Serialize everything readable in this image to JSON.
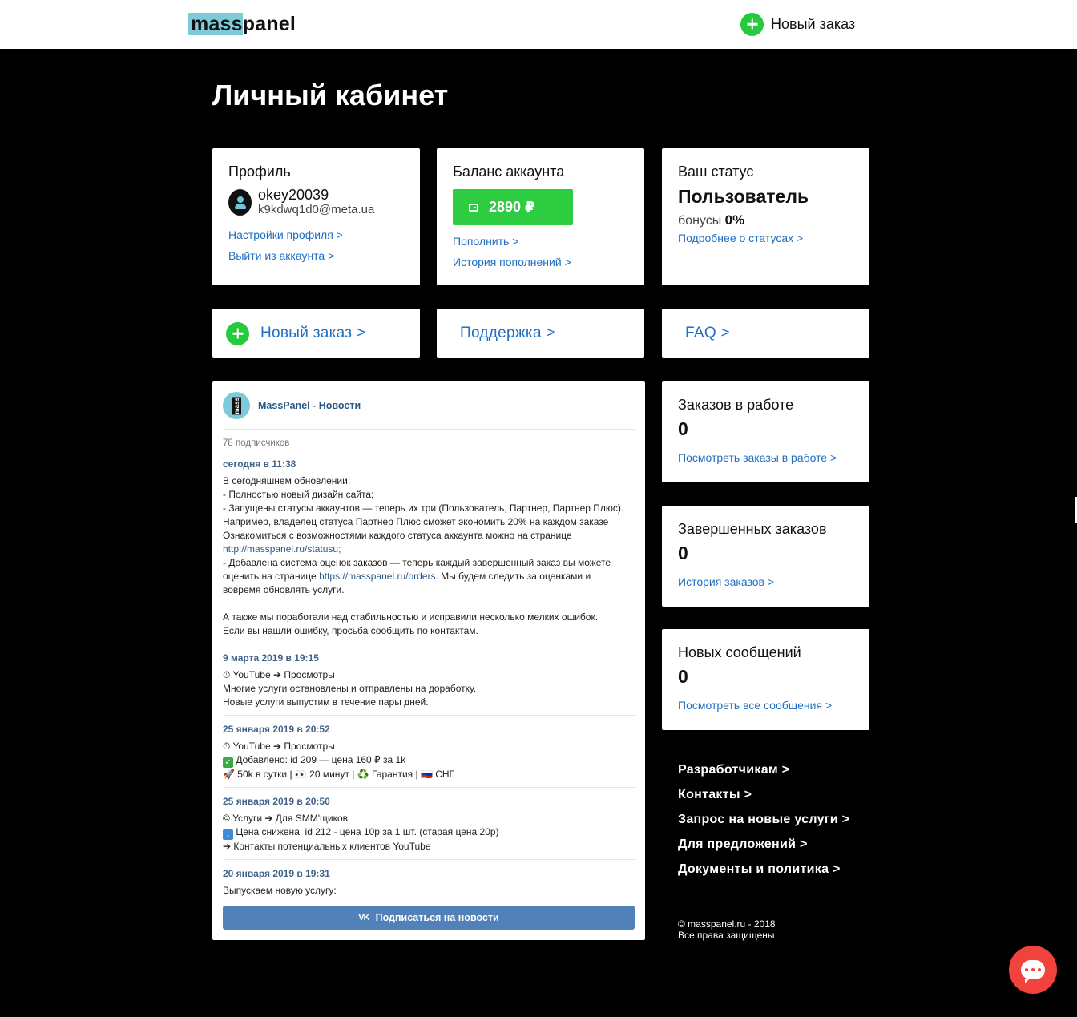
{
  "header": {
    "logo_highlight": "mass",
    "logo_rest": "panel",
    "new_order_label": "Новый заказ"
  },
  "page_title": "Личный кабинет",
  "profile": {
    "title": "Профиль",
    "username": "okey20039",
    "email": "k9kdwq1d0@meta.ua",
    "settings_link": "Настройки профиля >",
    "logout_link": "Выйти из аккаунта >"
  },
  "balance": {
    "title": "Баланс аккаунта",
    "amount": "2890 ₽",
    "topup_link": "Пополнить >",
    "history_link": "История пополнений >"
  },
  "status": {
    "title": "Ваш статус",
    "name": "Пользователь",
    "bonus_label": "бонусы",
    "bonus_value": "0%",
    "more_link": "Подробнее о статусах >"
  },
  "nav": {
    "new_order": "Новый заказ >",
    "support": "Поддержка >",
    "faq": "FAQ >"
  },
  "news": {
    "group_name": "MassPanel - Новости",
    "avatar_text": "mass",
    "subscribers": "78 подписчиков",
    "subscribe_button": "Подписаться на новости",
    "vk_icon": "VK",
    "posts": [
      {
        "date": "сегодня в 11:38",
        "lines": [
          "В сегодняшнем обновлении:",
          "- Полностью новый дизайн сайта;",
          "- Запущены статусы аккаунтов — теперь их три (Пользователь, Партнер, Партнер Плюс).",
          "Например, владелец статуса Партнер Плюс сможет экономить 20% на каждом заказе",
          "Ознакомиться с возможностями каждого статуса аккаунта можно на странице",
          "http://masspanel.ru/statusu;",
          "- Добавлена система оценок заказов — теперь каждый завершенный заказ вы можете",
          "оценить на странице ",
          "https://masspanel.ru/orders",
          ". Мы будем следить за оценками и",
          "вовремя обновлять услуги.",
          "А также мы поработали над стабильностью и исправили несколько мелких ошибок.",
          "Если вы нашли ошибку, просьба сообщить по контактам."
        ]
      },
      {
        "date": "9 марта 2019 в 19:15",
        "lines": [
          "⏱ YouTube ➔ Просмотры",
          "Многие услуги остановлены и отправлены на доработку.",
          "Новые услуги выпустим в течение пары дней."
        ]
      },
      {
        "date": "25 января 2019 в 20:52",
        "lines": [
          "⏱ YouTube ➔ Просмотры",
          "Добавлено: id 209 — цена 160 ₽ за 1k",
          "🚀 50k в сутки | 👀 20 минут | ♻️ Гарантия | 🇷🇺 СНГ"
        ]
      },
      {
        "date": "25 января 2019 в 20:50",
        "lines": [
          "© Услуги ➔ Для SMM'щиков",
          "Цена снижена: id 212 - цена 10р за 1 шт. (старая цена 20р)",
          "➔ Контакты потенциальных клиентов YouTube"
        ]
      },
      {
        "date": "20 января 2019 в 19:31",
        "lines": [
          "Выпускаем новую услугу:"
        ]
      }
    ]
  },
  "stats": {
    "work": {
      "title": "Заказов в работе",
      "value": "0",
      "link": "Посмотреть заказы в работе >"
    },
    "done": {
      "title": "Завершенных заказов",
      "value": "0",
      "link": "История заказов >"
    },
    "messages": {
      "title": "Новых сообщений",
      "value": "0",
      "link": "Посмотреть все сообщения >"
    }
  },
  "footer": {
    "links": [
      "Разработчикам >",
      "Контакты >",
      "Запрос на новые услуги >",
      "Для предложений >",
      "Документы и политика >"
    ],
    "copyright_line1": "© masspanel.ru - 2018",
    "copyright_line2": "Все права защищены"
  },
  "colors": {
    "accent_link": "#1f6fc2",
    "green": "#2ecc40",
    "logo_highlight": "#7dcbd8",
    "vk_blue": "#5181b8",
    "chat_red": "#f0433d"
  },
  "icons": [
    "plus-circle-icon",
    "user-avatar-icon",
    "wallet-icon",
    "vk-icon",
    "chat-icon"
  ]
}
